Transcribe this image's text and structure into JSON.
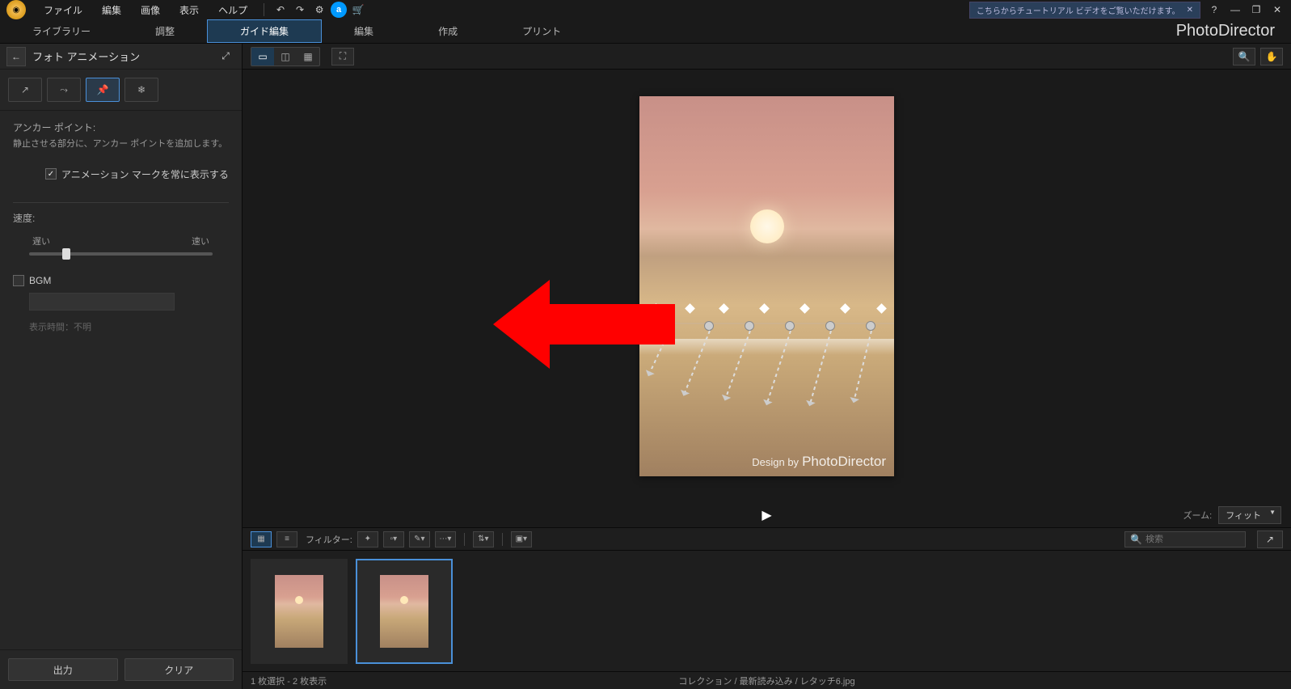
{
  "menu": {
    "file": "ファイル",
    "edit": "編集",
    "image": "画像",
    "view": "表示",
    "help": "ヘルプ"
  },
  "tutorial_banner": "こちらからチュートリアル ビデオをご覧いただけます。",
  "tabs": {
    "library": "ライブラリー",
    "adjust": "調整",
    "guided": "ガイド編集",
    "edit": "編集",
    "create": "作成",
    "print": "プリント"
  },
  "brand": "PhotoDirector",
  "panel": {
    "title": "フォト アニメーション",
    "anchor_label": "アンカー ポイント:",
    "anchor_desc": "静止させる部分に、アンカー ポイントを追加します。",
    "show_marks": "アニメーション マークを常に表示する",
    "speed_label": "速度:",
    "speed_slow": "遅い",
    "speed_fast": "速い",
    "bgm_label": "BGM",
    "duration_label": "表示時間：",
    "duration_value": "不明",
    "export": "出力",
    "clear": "クリア"
  },
  "watermark": {
    "prefix": "Design by",
    "brand": "PhotoDirector"
  },
  "zoom": {
    "label": "ズーム:",
    "value": "フィット"
  },
  "filter_label": "フィルター:",
  "search_placeholder": "検索",
  "status": {
    "selection": "1 枚選択 - 2 枚表示",
    "path": "コレクション / 最新読み込み / レタッチ6.jpg"
  }
}
